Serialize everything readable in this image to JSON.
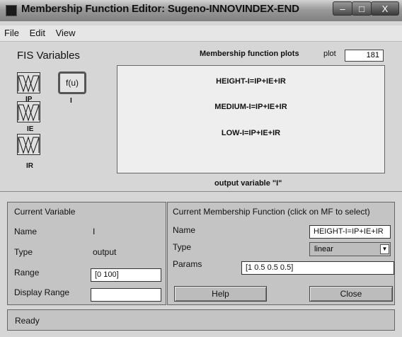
{
  "window": {
    "title": "Membership Function Editor: Sugeno-INNOVINDEX-END",
    "buttons": [
      "–",
      "□",
      "X"
    ]
  },
  "menu": [
    "File",
    "Edit",
    "View"
  ],
  "fis": {
    "title": "FIS Variables",
    "inputs": [
      "IP",
      "IE",
      "IR"
    ],
    "output": {
      "box_label": "f(u)",
      "name": "I"
    }
  },
  "plot": {
    "title": "Membership function plots",
    "points_label": "plot",
    "points_value": "181",
    "mfs": [
      "HEIGHT-I=IP+IE+IR",
      "MEDIUM-I=IP+IE+IR",
      "LOW-I=IP+IE+IR"
    ],
    "caption": "output variable \"I\""
  },
  "current_variable": {
    "title": "Current Variable",
    "name_label": "Name",
    "name_value": "I",
    "type_label": "Type",
    "type_value": "output",
    "range_label": "Range",
    "range_value": "[0 100]",
    "display_range_label": "Display Range",
    "display_range_value": ""
  },
  "current_mf": {
    "title": "Current Membership Function (click on MF to select)",
    "name_label": "Name",
    "name_value": "HEIGHT-I=IP+IE+IR",
    "type_label": "Type",
    "type_value": "linear",
    "params_label": "Params",
    "params_value": "[1 0.5 0.5 0.5]"
  },
  "buttons": {
    "help": "Help",
    "close": "Close"
  },
  "status": "Ready"
}
